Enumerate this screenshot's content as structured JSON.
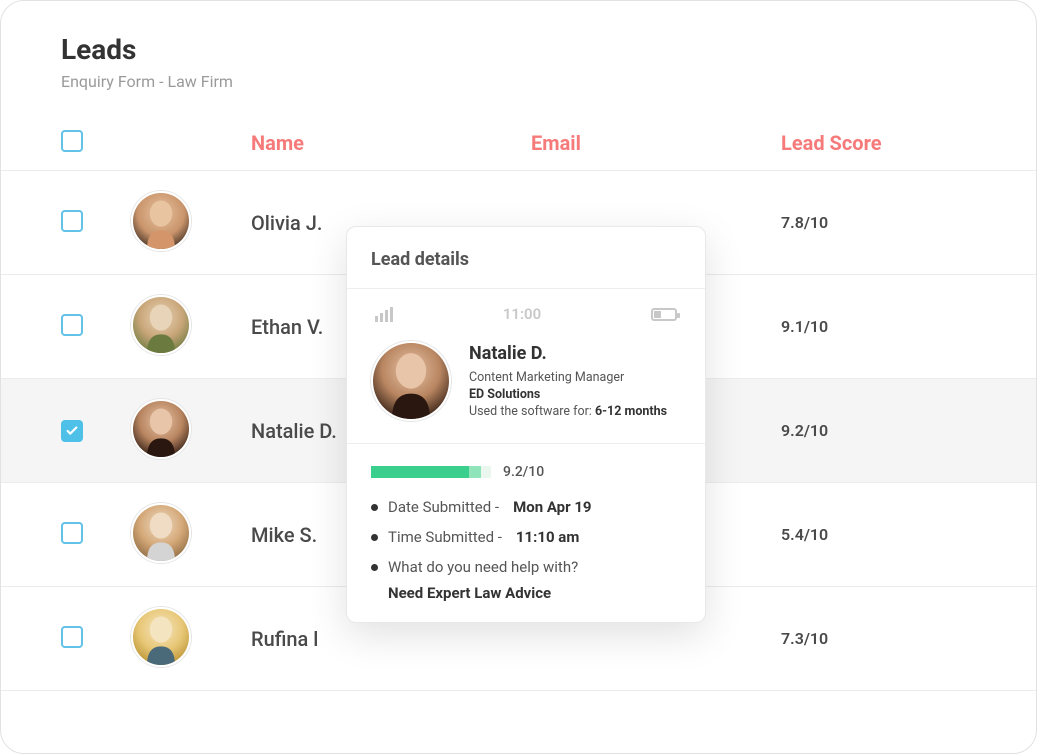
{
  "header": {
    "title": "Leads",
    "subtitle": "Enquiry Form - Law Firm"
  },
  "table": {
    "columns": {
      "name": "Name",
      "email": "Email",
      "score": "Lead Score"
    },
    "rows": [
      {
        "name": "Olivia J.",
        "score": "7.8/10",
        "checked": false,
        "avatar": "f1"
      },
      {
        "name": "Ethan V.",
        "score": "9.1/10",
        "checked": false,
        "avatar": "m1"
      },
      {
        "name": "Natalie D.",
        "score": "9.2/10",
        "checked": true,
        "avatar": "f2"
      },
      {
        "name": "Mike S.",
        "score": "5.4/10",
        "checked": false,
        "avatar": "m2"
      },
      {
        "name": "Rufina l",
        "score": "7.3/10",
        "checked": false,
        "avatar": "f3"
      }
    ]
  },
  "detail": {
    "title": "Lead details",
    "status_time": "11:00",
    "person": {
      "name": "Natalie D.",
      "role": "Content Marketing Manager",
      "company": "ED Solutions",
      "usage_label": "Used the software for:",
      "usage_value": "6-12 months",
      "avatar": "f2"
    },
    "score": {
      "value": "9.2/10",
      "percent": 82,
      "percent_light": 92
    },
    "fields": {
      "date_label": "Date Submitted -",
      "date_value": "Mon Apr 19",
      "time_label": "Time Submitted -",
      "time_value": "11:10 am",
      "help_label": "What do you need help with?",
      "help_value": "Need Expert Law Advice"
    }
  },
  "colors": {
    "accent_red": "#f77a7a",
    "checkbox_blue": "#4fc1e9",
    "progress_green": "#3bcf8e"
  }
}
